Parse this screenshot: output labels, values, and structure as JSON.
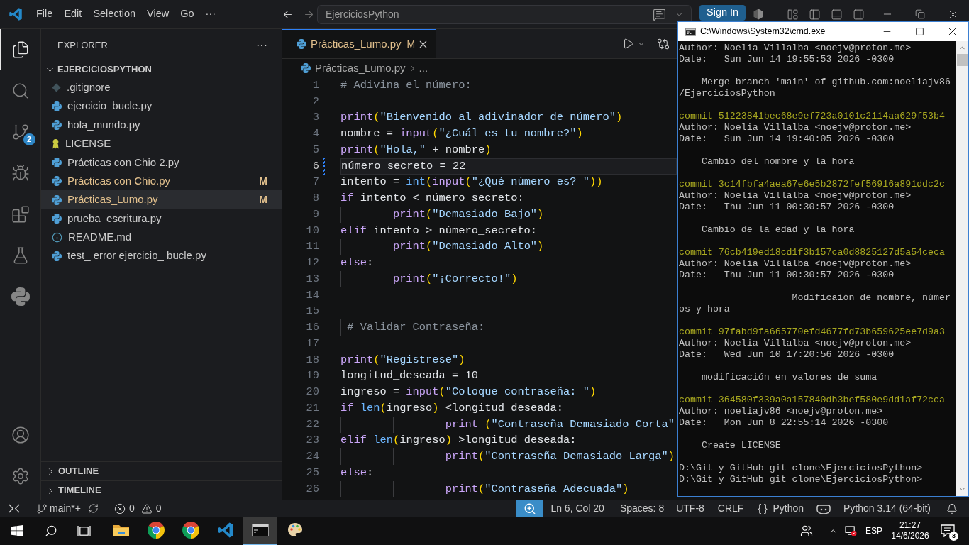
{
  "title_bar": {
    "menu": [
      {
        "label": "File"
      },
      {
        "label": "Edit"
      },
      {
        "label": "Selection"
      },
      {
        "label": "View"
      },
      {
        "label": "Go"
      },
      {
        "label": "···"
      }
    ],
    "command_center": "EjerciciosPython",
    "sign_in": "Sign In"
  },
  "activity_bar": {
    "items": [
      {
        "kind": "explorer",
        "selected": true
      },
      {
        "kind": "search",
        "selected": false
      },
      {
        "kind": "source_control",
        "selected": false,
        "badge": "2"
      },
      {
        "kind": "run_debug",
        "selected": false
      },
      {
        "kind": "extensions",
        "selected": false
      },
      {
        "kind": "testing",
        "selected": false
      },
      {
        "kind": "python",
        "selected": false
      }
    ],
    "bottom": [
      {
        "kind": "account"
      },
      {
        "kind": "settings"
      }
    ]
  },
  "explorer": {
    "title": "EXPLORER",
    "more": "···",
    "folder": {
      "name": "EJERCICIOSPYTHON",
      "expanded": true,
      "children": [
        {
          "name": ".gitignore",
          "kind": "git",
          "modified": false,
          "selected": false
        },
        {
          "name": "ejercicio_bucle.py",
          "kind": "python",
          "modified": false,
          "selected": false
        },
        {
          "name": "hola_mundo.py",
          "kind": "python",
          "modified": false,
          "selected": false
        },
        {
          "name": "LICENSE",
          "kind": "license",
          "modified": false,
          "selected": false
        },
        {
          "name": "Prácticas con Chio 2.py",
          "kind": "python",
          "modified": false,
          "selected": false
        },
        {
          "name": "Prácticas con Chio.py",
          "kind": "python",
          "modified": true,
          "status": "M",
          "selected": false
        },
        {
          "name": "Prácticas_Lumo.py",
          "kind": "python",
          "modified": true,
          "status": "M",
          "selected": true
        },
        {
          "name": "prueba_escritura.py",
          "kind": "python",
          "modified": false,
          "selected": false
        },
        {
          "name": "README.md",
          "kind": "info",
          "modified": false,
          "selected": false
        },
        {
          "name": "test_ error ejercicio_ bucle.py",
          "kind": "python",
          "modified": false,
          "selected": false
        }
      ]
    },
    "sections": [
      {
        "name": "OUTLINE",
        "expanded": false
      },
      {
        "name": "TIMELINE",
        "expanded": false
      }
    ]
  },
  "editor": {
    "tabs": [
      {
        "name": "Prácticas_Lumo.py",
        "status": "M",
        "modified": true,
        "selected": true
      }
    ],
    "breadcrumb": [
      {
        "kind": "file",
        "text": "Prácticas_Lumo.py"
      },
      {
        "kind": "symbol",
        "text": "..."
      }
    ],
    "lines": [
      {
        "number": "1",
        "current": false,
        "changed": false,
        "tokens": [
          {
            "text": "# Adivina el número:",
            "kind": "comment"
          }
        ]
      },
      {
        "number": "2",
        "current": false,
        "changed": false
      },
      {
        "number": "3",
        "current": false,
        "changed": false,
        "tokens": [
          {
            "text": "print",
            "kind": "keyword"
          },
          {
            "text": "(",
            "kind": "bracket"
          },
          {
            "text": "\"Bienvenido al adivinador de número\"",
            "kind": "string"
          },
          {
            "text": ")",
            "kind": "bracket"
          }
        ]
      },
      {
        "number": "4",
        "current": false,
        "changed": false,
        "tokens": [
          {
            "text": "nombre = ",
            "kind": "plain"
          },
          {
            "text": "input",
            "kind": "keyword"
          },
          {
            "text": "(",
            "kind": "bracket"
          },
          {
            "text": "\"¿Cuál es tu nombre?\"",
            "kind": "string"
          },
          {
            "text": ")",
            "kind": "bracket"
          }
        ]
      },
      {
        "number": "5",
        "current": false,
        "changed": false,
        "tokens": [
          {
            "text": "print",
            "kind": "keyword"
          },
          {
            "text": "(",
            "kind": "bracket"
          },
          {
            "text": "\"Hola,\"",
            "kind": "string"
          },
          {
            "text": " + nombre",
            "kind": "plain"
          },
          {
            "text": ")",
            "kind": "bracket"
          }
        ]
      },
      {
        "number": "6",
        "current": true,
        "changed": true,
        "tokens": [
          {
            "text": "número_secreto = 22",
            "kind": "plain"
          }
        ]
      },
      {
        "number": "7",
        "current": false,
        "changed": false,
        "tokens": [
          {
            "text": "intento = ",
            "kind": "plain"
          },
          {
            "text": "int",
            "kind": "function"
          },
          {
            "text": "(",
            "kind": "bracket"
          },
          {
            "text": "input",
            "kind": "keyword"
          },
          {
            "text": "(",
            "kind": "bracket"
          },
          {
            "text": "\"¿Qué número es? \"",
            "kind": "string"
          },
          {
            "text": "))",
            "kind": "bracket"
          }
        ]
      },
      {
        "number": "8",
        "current": false,
        "changed": false,
        "tokens": [
          {
            "text": "if",
            "kind": "keyword"
          },
          {
            "text": " intento < número_secreto:",
            "kind": "plain"
          }
        ]
      },
      {
        "number": "9",
        "current": false,
        "changed": false,
        "tokens": [
          {
            "text": "\tprint",
            "kind": "keyword"
          },
          {
            "text": "(",
            "kind": "bracket"
          },
          {
            "text": "\"Demasiado Bajo\"",
            "kind": "string"
          },
          {
            "text": ")",
            "kind": "bracket"
          }
        ]
      },
      {
        "number": "10",
        "current": false,
        "changed": false,
        "tokens": [
          {
            "text": "elif",
            "kind": "keyword"
          },
          {
            "text": " intento > número_secreto:",
            "kind": "plain"
          }
        ]
      },
      {
        "number": "11",
        "current": false,
        "changed": false,
        "tokens": [
          {
            "text": "\tprint",
            "kind": "keyword"
          },
          {
            "text": "(",
            "kind": "bracket"
          },
          {
            "text": "\"Demasiado Alto\"",
            "kind": "string"
          },
          {
            "text": ")",
            "kind": "bracket"
          }
        ]
      },
      {
        "number": "12",
        "current": false,
        "changed": false,
        "tokens": [
          {
            "text": "else",
            "kind": "keyword"
          },
          {
            "text": ":",
            "kind": "plain"
          }
        ]
      },
      {
        "number": "13",
        "current": false,
        "changed": false,
        "tokens": [
          {
            "text": "\tprint",
            "kind": "keyword"
          },
          {
            "text": "(",
            "kind": "bracket"
          },
          {
            "text": "\"¡Correcto!\"",
            "kind": "string"
          },
          {
            "text": ")",
            "kind": "bracket"
          }
        ]
      },
      {
        "number": "14",
        "current": false,
        "changed": false
      },
      {
        "number": "15",
        "current": false,
        "changed": false
      },
      {
        "number": "16",
        "current": false,
        "changed": false,
        "tokens": [
          {
            "text": " # Validar Contraseña:",
            "kind": "comment"
          }
        ]
      },
      {
        "number": "17",
        "current": false,
        "changed": false
      },
      {
        "number": "18",
        "current": false,
        "changed": false,
        "tokens": [
          {
            "text": "print",
            "kind": "keyword"
          },
          {
            "text": "(",
            "kind": "bracket"
          },
          {
            "text": "\"Registrese\"",
            "kind": "string"
          },
          {
            "text": ")",
            "kind": "bracket"
          }
        ]
      },
      {
        "number": "19",
        "current": false,
        "changed": false,
        "tokens": [
          {
            "text": "longitud_deseada = 10",
            "kind": "plain"
          }
        ]
      },
      {
        "number": "20",
        "current": false,
        "changed": false,
        "tokens": [
          {
            "text": "ingreso = ",
            "kind": "plain"
          },
          {
            "text": "input",
            "kind": "keyword"
          },
          {
            "text": "(",
            "kind": "bracket"
          },
          {
            "text": "\"Coloque contraseña: \"",
            "kind": "string"
          },
          {
            "text": ")",
            "kind": "bracket"
          }
        ]
      },
      {
        "number": "21",
        "current": false,
        "changed": false,
        "tokens": [
          {
            "text": "if",
            "kind": "keyword"
          },
          {
            "text": " len",
            "kind": "function"
          },
          {
            "text": "(",
            "kind": "bracket"
          },
          {
            "text": "ingreso",
            "kind": "plain"
          },
          {
            "text": ")",
            "kind": "bracket"
          },
          {
            "text": " <longitud_deseada:",
            "kind": "plain"
          }
        ]
      },
      {
        "number": "22",
        "current": false,
        "changed": false,
        "tokens": [
          {
            "text": "\t\tprint ",
            "kind": "keyword"
          },
          {
            "text": "(",
            "kind": "bracket"
          },
          {
            "text": "\"Contraseña Demasiado Corta\"",
            "kind": "string"
          }
        ]
      },
      {
        "number": "23",
        "current": false,
        "changed": false,
        "tokens": [
          {
            "text": "elif",
            "kind": "keyword"
          },
          {
            "text": " len",
            "kind": "function"
          },
          {
            "text": "(",
            "kind": "bracket"
          },
          {
            "text": "ingreso",
            "kind": "plain"
          },
          {
            "text": ")",
            "kind": "bracket"
          },
          {
            "text": " >longitud_deseada:",
            "kind": "plain"
          }
        ]
      },
      {
        "number": "24",
        "current": false,
        "changed": false,
        "tokens": [
          {
            "text": "\t\tprint",
            "kind": "keyword"
          },
          {
            "text": "(",
            "kind": "bracket"
          },
          {
            "text": "\"Contraseña Demasiado Larga\"",
            "kind": "string"
          },
          {
            "text": ")",
            "kind": "bracket"
          }
        ]
      },
      {
        "number": "25",
        "current": false,
        "changed": false,
        "tokens": [
          {
            "text": "else",
            "kind": "keyword"
          },
          {
            "text": ":",
            "kind": "plain"
          }
        ]
      },
      {
        "number": "26",
        "current": false,
        "changed": false,
        "tokens": [
          {
            "text": "\t\tprint",
            "kind": "keyword"
          },
          {
            "text": "(",
            "kind": "bracket"
          },
          {
            "text": "\"Contraseña Adecuada\"",
            "kind": "string"
          },
          {
            "text": ")",
            "kind": "bracket"
          }
        ]
      }
    ]
  },
  "terminal_window": {
    "title": "C:\\Windows\\System32\\cmd.exe",
    "lines": [
      {
        "kind": "plain",
        "text": "Author: Noelia Villalba <noejv@proton.me>"
      },
      {
        "kind": "plain",
        "text": "Date:   Sun Jun 14 19:55:53 2026 -0300"
      },
      {
        "kind": "blank"
      },
      {
        "kind": "plain",
        "text": "    Merge branch 'main' of github.com:noeliajv86"
      },
      {
        "kind": "plain",
        "text": "/EjerciciosPython"
      },
      {
        "kind": "blank"
      },
      {
        "kind": "commit",
        "text": "commit 51223841bec68e9ef723a0101c2114aa629f53b4"
      },
      {
        "kind": "plain",
        "text": "Author: Noelia Villalba <noejv@proton.me>"
      },
      {
        "kind": "plain",
        "text": "Date:   Sun Jun 14 19:40:05 2026 -0300"
      },
      {
        "kind": "blank"
      },
      {
        "kind": "plain",
        "text": "    Cambio del nombre y la hora"
      },
      {
        "kind": "blank"
      },
      {
        "kind": "commit",
        "text": "commit 3c14fbfa4aea67e6e5b2872fef56916a891ddc2c"
      },
      {
        "kind": "plain",
        "text": "Author: Noelia Villalba <noejv@proton.me>"
      },
      {
        "kind": "plain",
        "text": "Date:   Thu Jun 11 00:30:57 2026 -0300"
      },
      {
        "kind": "blank"
      },
      {
        "kind": "plain",
        "text": "    Cambio de la edad y la hora"
      },
      {
        "kind": "blank"
      },
      {
        "kind": "commit",
        "text": "commit 76cb419ed18cd1f3b157ca0d8825127d5a54ceca"
      },
      {
        "kind": "plain",
        "text": "Author: Noelia Villalba <noejv@proton.me>"
      },
      {
        "kind": "plain",
        "text": "Date:   Thu Jun 11 00:30:57 2026 -0300"
      },
      {
        "kind": "blank"
      },
      {
        "kind": "plain",
        "text": "                    Modificaión de nombre, númer"
      },
      {
        "kind": "plain",
        "text": "os y hora"
      },
      {
        "kind": "blank"
      },
      {
        "kind": "commit",
        "text": "commit 97fabd9fa665770efd4677fd73b659625ee7d9a3"
      },
      {
        "kind": "plain",
        "text": "Author: Noelia Villalba <noejv@proton.me>"
      },
      {
        "kind": "plain",
        "text": "Date:   Wed Jun 10 17:20:56 2026 -0300"
      },
      {
        "kind": "blank"
      },
      {
        "kind": "plain",
        "text": "    modificación en valores de suma"
      },
      {
        "kind": "blank"
      },
      {
        "kind": "commit",
        "text": "commit 364580f339a0a157840db3bef580e9dd1af72cca"
      },
      {
        "kind": "plain",
        "text": "Author: noeliajv86 <noejv@proton.me>"
      },
      {
        "kind": "plain",
        "text": "Date:   Mon Jun 8 22:55:14 2026 -0300"
      },
      {
        "kind": "blank"
      },
      {
        "kind": "plain",
        "text": "    Create LICENSE"
      },
      {
        "kind": "blank"
      },
      {
        "kind": "plain",
        "text": "D:\\Git y GitHub git clone\\EjerciciosPython>"
      },
      {
        "kind": "plain",
        "text": "D:\\Git y GitHub git clone\\EjerciciosPython>"
      }
    ]
  },
  "status_bar": {
    "branch": "main*+",
    "errors": "0",
    "warnings": "0",
    "position": "Ln 6, Col 20",
    "indentation": "Spaces: 8",
    "encoding": "UTF-8",
    "line_ending": "CRLF",
    "language_icon": "{ }",
    "language": "Python",
    "interpreter": "Python 3.14 (64-bit)"
  },
  "taskbar": {
    "apps": [
      {
        "kind": "file_explorer",
        "selected": false
      },
      {
        "kind": "chrome",
        "selected": false
      },
      {
        "kind": "chrome",
        "selected": false
      },
      {
        "kind": "vscode",
        "selected": false
      },
      {
        "kind": "terminal",
        "selected": true
      },
      {
        "kind": "paint",
        "selected": false
      }
    ],
    "input_language": "ESP",
    "time": "21:27",
    "date": "14/6/2026",
    "notification_count": "3"
  }
}
